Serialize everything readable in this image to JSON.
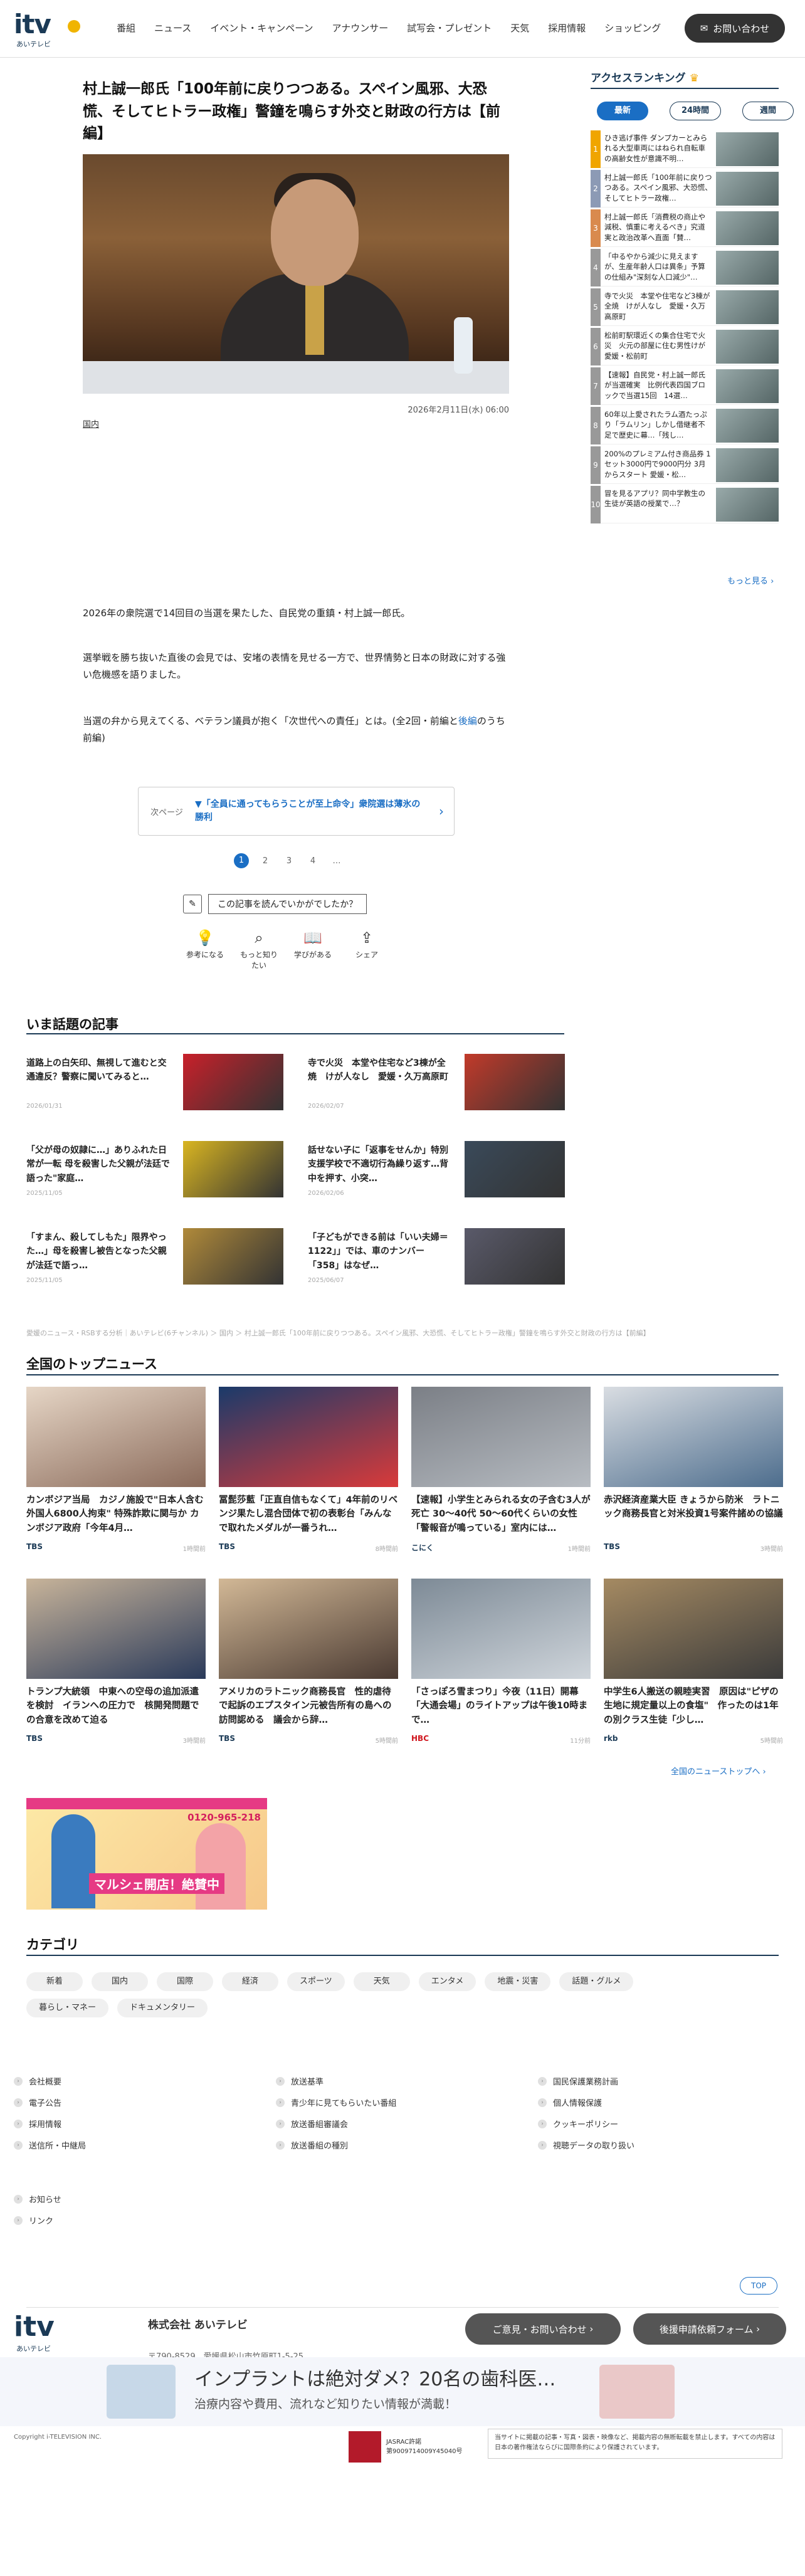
{
  "header": {
    "logo_word": "itv",
    "logo_sub": "あいテレビ",
    "nav": [
      "番組",
      "ニュース",
      "イベント・キャンペーン",
      "アナウンサー",
      "試写会・プレゼント",
      "天気",
      "採用情報",
      "ショッピング"
    ],
    "contact_label": "お問い合わせ"
  },
  "article": {
    "title": "村上誠一郎氏「100年前に戻りつつある。スペイン風邪、大恐慌、そしてヒトラー政権」警鐘を鳴らす外交と財政の行方は【前編】",
    "date": "2026年2月11日(水) 06:00",
    "tag": "国内",
    "p1": "2026年の衆院選で14回目の当選を果たした、自民党の重鎮・村上誠一郎氏。",
    "p2": "選挙戦を勝ち抜いた直後の会見では、安堵の表情を見せる一方で、世界情勢と日本の財政に対する強い危機感を語りました。",
    "p3a": "当選の弁から見えてくる、ベテラン議員が抱く「次世代への責任」とは。(全2回・前編と",
    "p3link": "後編",
    "p3b": "のうち前編)",
    "next_label": "次ページ",
    "next_text": "▼「全員に通ってもらうことが至上命令」衆院選は薄氷の勝利",
    "pages": [
      "1",
      "2",
      "3",
      "4",
      "…"
    ],
    "feedback_q": "この記事を読んでいかがでしたか？",
    "feedback": [
      "参考になる",
      "もっと知りたい",
      "学びがある",
      "シェア"
    ]
  },
  "ranking": {
    "heading": "アクセスランキング",
    "tabs": [
      "最新",
      "24時間",
      "週間"
    ],
    "items": [
      {
        "n": "1",
        "t": "ひき逃げ事件 ダンプカーとみられる大型車両にはねられ自転車の高齢女性が意識不明…",
        "c": "#f0a500"
      },
      {
        "n": "2",
        "t": "村上誠一郎氏「100年前に戻りつつある。スペイン風邪、大恐慌、そしてヒトラー政権…",
        "c": "#8c9ab5"
      },
      {
        "n": "3",
        "t": "村上誠一郎氏「消費税の商止や減税、慎重に考えるべき」究道実と政治改革へ直面「賛…",
        "c": "#d98a4e"
      },
      {
        "n": "4",
        "t": "「中るやから減少に見えますが、生産年齢人口は異条」予算の仕組み\"深刻な人口減少\"…",
        "c": "#999"
      },
      {
        "n": "5",
        "t": "寺で火災　本堂や住宅など3棟が全焼　けが人なし　愛媛・久万高原町",
        "c": "#999"
      },
      {
        "n": "6",
        "t": "松前町駅環近くの集合住宅で火災　火元の部屋に住む男性けが 愛媛・松前町",
        "c": "#999"
      },
      {
        "n": "7",
        "t": "【速報】自民党・村上誠一郎氏が当選確実　比例代表四国ブロックで当選15回　14選…",
        "c": "#999"
      },
      {
        "n": "8",
        "t": "60年以上愛されたラム酒たっぷり「ラムリン」しかし借継者不足で歴史に幕…「残し…",
        "c": "#999"
      },
      {
        "n": "9",
        "t": "200%のプレミアム付き商品券 1セット3000円で9000円分 3月からスタート 愛媛・松…",
        "c": "#999"
      },
      {
        "n": "10",
        "t": "冒を見るアプリ？同中学教生の生徒が英語の授業で…？",
        "c": "#999"
      }
    ],
    "more": "もっと見る ›"
  },
  "hot": {
    "heading": "いま話題の記事",
    "items": [
      {
        "t": "道路上の白矢印、無視して進むと交通違反？警察に聞いてみると…",
        "d": "2026/01/31"
      },
      {
        "t": "寺で火災　本堂や住宅など3棟が全焼　けが人なし　愛媛・久万高原町",
        "d": "2026/02/07"
      },
      {
        "t": "「父が母の奴隷に…」ありふれた日常が一転 母を殺害した父親が法廷で語った\"家庭…",
        "d": "2025/11/05"
      },
      {
        "t": "話せない子に「返事をせんか」特別支援学校で不適切行為繰り返す…背中を押す、小突…",
        "d": "2026/02/06"
      },
      {
        "t": "「すまん、殺してしもた」限界やった…」母を殺害し被告となった父親が法廷で語っ…",
        "d": "2025/11/05"
      },
      {
        "t": "「子どもができる前は「いい夫婦＝1122」」では、車のナンバー「358」はなぜ…",
        "d": "2025/06/07"
      }
    ]
  },
  "breadcrumb": "愛媛のニュース・RSBする分析｜あいテレビ(6チャンネル) ＞ 国内 ＞ 村上誠一郎氏「100年前に戻りつつある。スペイン風邪、大恐慌、そしてヒトラー政権」警鐘を鳴らす外交と財政の行方は【前編】",
  "top_news": {
    "heading": "全国のトップニュース",
    "items": [
      {
        "t": "カンボジア当局　カジノ施設で\"日本人含む外国人6800人拘束\" 特殊詐欺に関与か カンボジア政府「今年4月…",
        "src": "TBS",
        "tm": "1時間前",
        "c1": "#8a6a5a",
        "c2": "#e6d6c6"
      },
      {
        "t": "冨髭莎藍「正直自信もなくて」4年前のリベンジ果たし混合団体で初の表彰台「みんなで取れたメダルが一番うれ…",
        "src": "TBS",
        "tm": "8時間前",
        "c1": "#d93a3a",
        "c2": "#1a3a6a"
      },
      {
        "t": "【速報】小学生とみられる女の子含む3人が死亡 30〜40代 50〜60代くらいの女性「警報音が鳴っている」室内には…",
        "src": "こにく",
        "tm": "1時間前",
        "c1": "#b7bcc2",
        "c2": "#7b7f86"
      },
      {
        "t": "赤沢経済産業大臣 きょうから防米　ラトニック商務長官と対米投資1号案件諸めの協議",
        "src": "TBS",
        "tm": "3時間前",
        "c1": "#4d6d8d",
        "c2": "#d9dde2"
      },
      {
        "t": "トランプ大統領　中東への空母の追加派遣を検討　イランへの圧力で　核開発問題での合意を改めて迫る",
        "src": "TBS",
        "tm": "3時間前",
        "c1": "#2a3a5a",
        "c2": "#c8b49a"
      },
      {
        "t": "アメリカのラトニック商務長官　性的虐待で起訴のエプスタイン元被告所有の島への訪問認める　議会から辞…",
        "src": "TBS",
        "tm": "5時間前",
        "c1": "#4a3a32",
        "c2": "#d2b896"
      },
      {
        "t": "「さっぽろ雪まつり」今夜（11日）開幕「大通会場」のライトアップは午後10時まで…",
        "src": "HBC",
        "tm": "11分前",
        "c1": "#cfd5db",
        "c2": "#7d8a96"
      },
      {
        "t": "中学生6人搬送の親睦実習　原因は\"ピザの生地に規定量以上の食塩\"　作ったのは1年の別クラス生徒「少し…",
        "src": "rkb",
        "tm": "5時間前",
        "c1": "#3b3b3b",
        "c2": "#a58a62"
      }
    ],
    "more": "全国のニューストップへ ›"
  },
  "banner": {
    "tel": "0120-965-218",
    "cap": "マルシェ開店！絶賛中"
  },
  "categories": {
    "heading": "カテゴリ",
    "items": [
      "新着",
      "国内",
      "国際",
      "経済",
      "スポーツ",
      "天気",
      "エンタメ",
      "地震・災害",
      "話題・グルメ",
      "暮らし・マネー",
      "ドキュメンタリー"
    ]
  },
  "footer": {
    "col1": [
      "会社概要",
      "電子公告",
      "採用情報",
      "送信所・中継局"
    ],
    "col2": [
      "放送基準",
      "青少年に見てもらいたい番組",
      "放送番組審議会",
      "放送番組の種別"
    ],
    "col3": [
      "国民保護業務計画",
      "個人情報保護",
      "クッキーポリシー",
      "視聴データの取り扱い"
    ],
    "col4": [
      "お知らせ",
      "リンク"
    ],
    "top": "TOP",
    "company": "株式会社 あいテレビ",
    "address": "〒790-8529　愛媛県松山市竹原町1-5-25",
    "btn1": "ご意見・お問い合わせ",
    "btn2": "後援申請依頼フォーム",
    "ad1": "インプラントは絶対ダメ？20名の歯科医…",
    "ad2": "治療内容や費用、流れなど知りたい情報が満載！",
    "copyright": "Copyright i-TELEVISION INC.",
    "jasrac1": "JASRAC許諾",
    "jasrac2": "第9009714009Y45040号",
    "notice": "当サイトに掲載の記事・写真・図表・映像など、掲載内容の無断転載を禁止します。すべての内容は日本の著作権法ならびに国際条約により保護されています。"
  }
}
